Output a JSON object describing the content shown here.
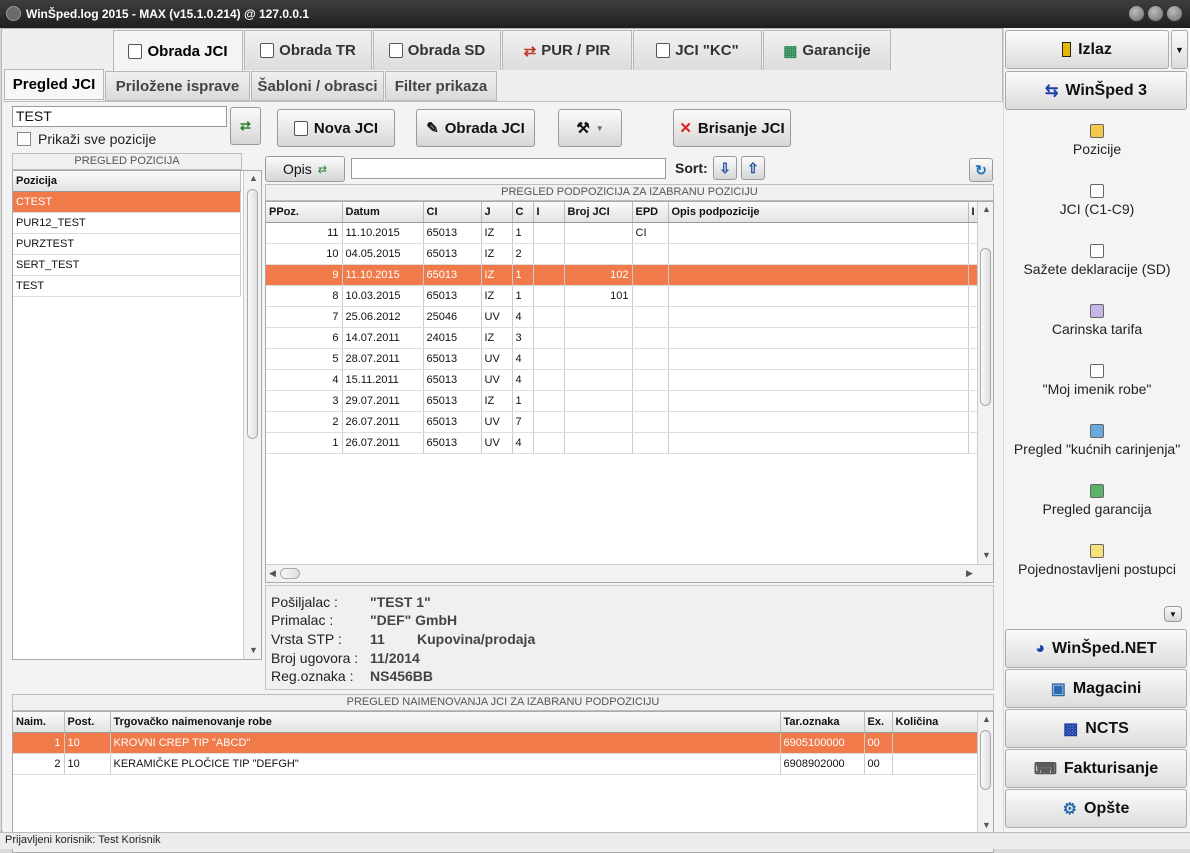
{
  "window": {
    "title": "WinŠped.log 2015 - MAX (v15.1.0.214) @ 127.0.0.1"
  },
  "top_tabs": [
    {
      "label": "Obrada JCI",
      "active": true
    },
    {
      "label": "Obrada TR"
    },
    {
      "label": "Obrada SD"
    },
    {
      "label": "PUR / PIR"
    },
    {
      "label": "JCI \"KC\""
    },
    {
      "label": "Garancije"
    }
  ],
  "sub_tabs": [
    {
      "label": "Pregled JCI",
      "active": true
    },
    {
      "label": "Priložene isprave"
    },
    {
      "label": "Šabloni / obrasci"
    },
    {
      "label": "Filter prikaza"
    }
  ],
  "filter": {
    "value": "TEST",
    "show_all_label": "Prikaži sve pozicije",
    "show_all_checked": false
  },
  "toolbar": {
    "new_label": "Nova JCI",
    "edit_label": "Obrada JCI",
    "delete_label": "Brisanje JCI"
  },
  "opis": {
    "label": "Opis",
    "value": "",
    "sort_label": "Sort:"
  },
  "positions": {
    "header": "PREGLED POZICIJA",
    "column": "Pozicija",
    "rows": [
      "CTEST",
      "PUR12_TEST",
      "PURZTEST",
      "SERT_TEST",
      "TEST"
    ],
    "selected": 0
  },
  "subpositions": {
    "header": "PREGLED PODPOZICIJA ZA IZABRANU POZICIJU",
    "columns": [
      "PPoz.",
      "Datum",
      "CI",
      "J",
      "C",
      "I",
      "Broj JCI",
      "EPD",
      "Opis podpozicije",
      "I"
    ],
    "rows": [
      [
        "11",
        "11.10.2015",
        "65013",
        "IZ",
        "1",
        "",
        "",
        "CI",
        ""
      ],
      [
        "10",
        "04.05.2015",
        "65013",
        "IZ",
        "2",
        "",
        "",
        "",
        ""
      ],
      [
        "9",
        "11.10.2015",
        "65013",
        "IZ",
        "1",
        "",
        "102",
        "",
        ""
      ],
      [
        "8",
        "10.03.2015",
        "65013",
        "IZ",
        "1",
        "",
        "101",
        "",
        ""
      ],
      [
        "7",
        "25.06.2012",
        "25046",
        "UV",
        "4",
        "",
        "",
        "",
        ""
      ],
      [
        "6",
        "14.07.2011",
        "24015",
        "IZ",
        "3",
        "",
        "",
        "",
        ""
      ],
      [
        "5",
        "28.07.2011",
        "65013",
        "UV",
        "4",
        "",
        "",
        "",
        ""
      ],
      [
        "4",
        "15.11.2011",
        "65013",
        "UV",
        "4",
        "",
        "",
        "",
        ""
      ],
      [
        "3",
        "29.07.2011",
        "65013",
        "IZ",
        "1",
        "",
        "",
        "",
        ""
      ],
      [
        "2",
        "26.07.2011",
        "65013",
        "UV",
        "7",
        "",
        "",
        "",
        ""
      ],
      [
        "1",
        "26.07.2011",
        "65013",
        "UV",
        "4",
        "",
        "",
        "",
        ""
      ]
    ],
    "selected": 2
  },
  "details": {
    "posiljalac_label": "Pošiljalac :",
    "posiljalac": "\"TEST 1\"",
    "primalac_label": "Primalac :",
    "primalac": "\"DEF\" GmbH",
    "vrsta_label": "Vrsta STP :",
    "vrsta_code": "11",
    "vrsta_name": "Kupovina/prodaja",
    "ugovor_label": "Broj ugovora :",
    "ugovor": "11/2014",
    "reg_label": "Reg.oznaka :",
    "reg": "NS456BB"
  },
  "items": {
    "header": "PREGLED NAIMENOVANJA JCI ZA IZABRANU PODPOZICIJU",
    "columns": [
      "Naim.",
      "Post.",
      "Trgovačko naimenovanje robe",
      "Tar.oznaka",
      "Ex.",
      "Količina"
    ],
    "rows": [
      [
        "1",
        "10",
        "KROVNI CREP TIP \"ABCD\"",
        "6905100000",
        "00",
        ""
      ],
      [
        "2",
        "10",
        "KERAMIČKE PLOČICE TIP \"DEFGH\"",
        "6908902000",
        "00",
        ""
      ]
    ],
    "selected": 0
  },
  "right_panel": {
    "izlaz": "Izlaz",
    "winsped3": "WinŠped 3",
    "items": [
      "Pozicije",
      "JCI (C1-C9)",
      "Sažete deklaracije (SD)",
      "Carinska tarifa",
      "\"Moj imenik robe\"",
      "Pregled \"kućnih carinjenja\"",
      "Pregled garancija",
      "Pojednostavljeni postupci"
    ],
    "bottom": [
      "WinŠped.NET",
      "Magacini",
      "NCTS",
      "Fakturisanje",
      "Opšte"
    ]
  },
  "status": {
    "text": "Prijavljeni korisnik: Test Korisnik"
  },
  "colors": {
    "selection": "#f07a4a"
  }
}
